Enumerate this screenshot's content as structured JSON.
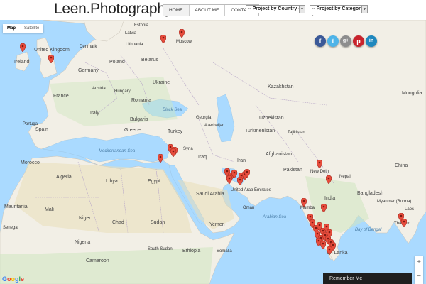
{
  "header": {
    "logo": "Leen.Photography",
    "nav": [
      "HOME",
      "ABOUT ME",
      "CONTACT"
    ],
    "country_select": "-- Project by Country --",
    "category_select": "-- Project by Category --"
  },
  "map": {
    "maptype": [
      "Map",
      "Satellite"
    ],
    "social": [
      {
        "icon": "facebook-icon",
        "glyph": "f",
        "color": "#3b5998"
      },
      {
        "icon": "twitter-icon",
        "glyph": "t",
        "color": "#4fb4e8"
      },
      {
        "icon": "google-plus-icon",
        "glyph": "g+",
        "color": "#8d8d8d"
      },
      {
        "icon": "pinterest-icon",
        "glyph": "p",
        "color": "#c8232c"
      },
      {
        "icon": "linkedin-icon",
        "glyph": "in",
        "color": "#1f88be"
      }
    ],
    "labels": {
      "estonia": "Estonia",
      "latvia": "Latvia",
      "lithuania": "Lithuania",
      "denmark": "Denmark",
      "united_kingdom": "United Kingdom",
      "ireland": "Ireland",
      "belarus": "Belarus",
      "moscow": "Moscow",
      "germany": "Germany",
      "poland": "Poland",
      "ukraine": "Ukraine",
      "france": "France",
      "austria": "Austria",
      "hungary": "Hungary",
      "romania": "Romania",
      "italy": "Italy",
      "bulgaria": "Bulgaria",
      "spain": "Spain",
      "portugal": "Portugal",
      "greece": "Greece",
      "turkey": "Turkey",
      "georgia": "Georgia",
      "azerbaijan": "Azerbaijan",
      "uzbekistan": "Uzbekistan",
      "turkmenistan": "Turkmenistan",
      "tajikistan": "Tajikistan",
      "kazakhstan": "Kazakhstan",
      "mongolia": "Mongolia",
      "black_sea": "Black Sea",
      "syria": "Syria",
      "iraq": "Iraq",
      "iran": "Iran",
      "afghanistan": "Afghanistan",
      "pakistan": "Pakistan",
      "new_delhi": "New Delhi",
      "nepal": "Nepal",
      "china": "China",
      "morocco": "Morocco",
      "algeria": "Algeria",
      "libya": "Libya",
      "egypt": "Egypt",
      "saudi_arabia": "Saudi Arabia",
      "united_arab_emirates": "United Arab Emirates",
      "oman": "Oman",
      "india": "India",
      "bangladesh": "Bangladesh",
      "myanmar": "Myanmar (Burma)",
      "mauritania": "Mauritania",
      "mali": "Mali",
      "niger": "Niger",
      "chad": "Chad",
      "sudan": "Sudan",
      "yemen": "Yemen",
      "ethiopia": "Ethiopia",
      "nigeria": "Nigeria",
      "cameroon": "Cameroon",
      "sri_lanka": "Sri Lanka",
      "mumbai": "Mumbai",
      "mediterranean_sea": "Mediterranean Sea",
      "arabian_sea": "Arabian Sea",
      "bay_of_bengal": "Bay of Bengal",
      "laos": "Laos",
      "thailand": "Thailand",
      "senegal": "Senegal",
      "south_sudan": "South Sudan",
      "somalia": "Somalia"
    },
    "google": "Google",
    "remember": "Remember Me",
    "zoom_in": "+",
    "zoom_out": "−"
  }
}
